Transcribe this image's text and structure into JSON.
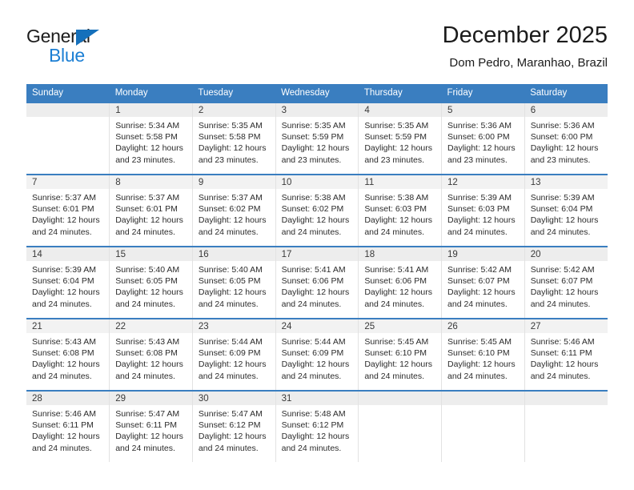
{
  "brand": {
    "name_part1": "General",
    "name_part2": "Blue",
    "color_dark": "#1b1b1b",
    "color_blue": "#1c7fd4",
    "triangle_color": "#1570bb"
  },
  "header": {
    "title": "December 2025",
    "subtitle": "Dom Pedro, Maranhao, Brazil"
  },
  "theme": {
    "header_bg": "#3a7ec0",
    "header_text": "#ffffff",
    "row_divider": "#3a7ec0",
    "daynum_bg": "#f2f2f2",
    "daynum_bg_alt": "#ededed",
    "cell_divider": "#e2e2e2"
  },
  "weekday_headers": [
    "Sunday",
    "Monday",
    "Tuesday",
    "Wednesday",
    "Thursday",
    "Friday",
    "Saturday"
  ],
  "weeks": [
    {
      "shaded": true,
      "days": [
        {
          "date": "",
          "sunrise": "",
          "sunset": "",
          "daylight_line1": "",
          "daylight_line2": ""
        },
        {
          "date": "1",
          "sunrise": "Sunrise: 5:34 AM",
          "sunset": "Sunset: 5:58 PM",
          "daylight_line1": "Daylight: 12 hours",
          "daylight_line2": "and 23 minutes."
        },
        {
          "date": "2",
          "sunrise": "Sunrise: 5:35 AM",
          "sunset": "Sunset: 5:58 PM",
          "daylight_line1": "Daylight: 12 hours",
          "daylight_line2": "and 23 minutes."
        },
        {
          "date": "3",
          "sunrise": "Sunrise: 5:35 AM",
          "sunset": "Sunset: 5:59 PM",
          "daylight_line1": "Daylight: 12 hours",
          "daylight_line2": "and 23 minutes."
        },
        {
          "date": "4",
          "sunrise": "Sunrise: 5:35 AM",
          "sunset": "Sunset: 5:59 PM",
          "daylight_line1": "Daylight: 12 hours",
          "daylight_line2": "and 23 minutes."
        },
        {
          "date": "5",
          "sunrise": "Sunrise: 5:36 AM",
          "sunset": "Sunset: 6:00 PM",
          "daylight_line1": "Daylight: 12 hours",
          "daylight_line2": "and 23 minutes."
        },
        {
          "date": "6",
          "sunrise": "Sunrise: 5:36 AM",
          "sunset": "Sunset: 6:00 PM",
          "daylight_line1": "Daylight: 12 hours",
          "daylight_line2": "and 23 minutes."
        }
      ]
    },
    {
      "shaded": false,
      "days": [
        {
          "date": "7",
          "sunrise": "Sunrise: 5:37 AM",
          "sunset": "Sunset: 6:01 PM",
          "daylight_line1": "Daylight: 12 hours",
          "daylight_line2": "and 24 minutes."
        },
        {
          "date": "8",
          "sunrise": "Sunrise: 5:37 AM",
          "sunset": "Sunset: 6:01 PM",
          "daylight_line1": "Daylight: 12 hours",
          "daylight_line2": "and 24 minutes."
        },
        {
          "date": "9",
          "sunrise": "Sunrise: 5:37 AM",
          "sunset": "Sunset: 6:02 PM",
          "daylight_line1": "Daylight: 12 hours",
          "daylight_line2": "and 24 minutes."
        },
        {
          "date": "10",
          "sunrise": "Sunrise: 5:38 AM",
          "sunset": "Sunset: 6:02 PM",
          "daylight_line1": "Daylight: 12 hours",
          "daylight_line2": "and 24 minutes."
        },
        {
          "date": "11",
          "sunrise": "Sunrise: 5:38 AM",
          "sunset": "Sunset: 6:03 PM",
          "daylight_line1": "Daylight: 12 hours",
          "daylight_line2": "and 24 minutes."
        },
        {
          "date": "12",
          "sunrise": "Sunrise: 5:39 AM",
          "sunset": "Sunset: 6:03 PM",
          "daylight_line1": "Daylight: 12 hours",
          "daylight_line2": "and 24 minutes."
        },
        {
          "date": "13",
          "sunrise": "Sunrise: 5:39 AM",
          "sunset": "Sunset: 6:04 PM",
          "daylight_line1": "Daylight: 12 hours",
          "daylight_line2": "and 24 minutes."
        }
      ]
    },
    {
      "shaded": true,
      "days": [
        {
          "date": "14",
          "sunrise": "Sunrise: 5:39 AM",
          "sunset": "Sunset: 6:04 PM",
          "daylight_line1": "Daylight: 12 hours",
          "daylight_line2": "and 24 minutes."
        },
        {
          "date": "15",
          "sunrise": "Sunrise: 5:40 AM",
          "sunset": "Sunset: 6:05 PM",
          "daylight_line1": "Daylight: 12 hours",
          "daylight_line2": "and 24 minutes."
        },
        {
          "date": "16",
          "sunrise": "Sunrise: 5:40 AM",
          "sunset": "Sunset: 6:05 PM",
          "daylight_line1": "Daylight: 12 hours",
          "daylight_line2": "and 24 minutes."
        },
        {
          "date": "17",
          "sunrise": "Sunrise: 5:41 AM",
          "sunset": "Sunset: 6:06 PM",
          "daylight_line1": "Daylight: 12 hours",
          "daylight_line2": "and 24 minutes."
        },
        {
          "date": "18",
          "sunrise": "Sunrise: 5:41 AM",
          "sunset": "Sunset: 6:06 PM",
          "daylight_line1": "Daylight: 12 hours",
          "daylight_line2": "and 24 minutes."
        },
        {
          "date": "19",
          "sunrise": "Sunrise: 5:42 AM",
          "sunset": "Sunset: 6:07 PM",
          "daylight_line1": "Daylight: 12 hours",
          "daylight_line2": "and 24 minutes."
        },
        {
          "date": "20",
          "sunrise": "Sunrise: 5:42 AM",
          "sunset": "Sunset: 6:07 PM",
          "daylight_line1": "Daylight: 12 hours",
          "daylight_line2": "and 24 minutes."
        }
      ]
    },
    {
      "shaded": false,
      "days": [
        {
          "date": "21",
          "sunrise": "Sunrise: 5:43 AM",
          "sunset": "Sunset: 6:08 PM",
          "daylight_line1": "Daylight: 12 hours",
          "daylight_line2": "and 24 minutes."
        },
        {
          "date": "22",
          "sunrise": "Sunrise: 5:43 AM",
          "sunset": "Sunset: 6:08 PM",
          "daylight_line1": "Daylight: 12 hours",
          "daylight_line2": "and 24 minutes."
        },
        {
          "date": "23",
          "sunrise": "Sunrise: 5:44 AM",
          "sunset": "Sunset: 6:09 PM",
          "daylight_line1": "Daylight: 12 hours",
          "daylight_line2": "and 24 minutes."
        },
        {
          "date": "24",
          "sunrise": "Sunrise: 5:44 AM",
          "sunset": "Sunset: 6:09 PM",
          "daylight_line1": "Daylight: 12 hours",
          "daylight_line2": "and 24 minutes."
        },
        {
          "date": "25",
          "sunrise": "Sunrise: 5:45 AM",
          "sunset": "Sunset: 6:10 PM",
          "daylight_line1": "Daylight: 12 hours",
          "daylight_line2": "and 24 minutes."
        },
        {
          "date": "26",
          "sunrise": "Sunrise: 5:45 AM",
          "sunset": "Sunset: 6:10 PM",
          "daylight_line1": "Daylight: 12 hours",
          "daylight_line2": "and 24 minutes."
        },
        {
          "date": "27",
          "sunrise": "Sunrise: 5:46 AM",
          "sunset": "Sunset: 6:11 PM",
          "daylight_line1": "Daylight: 12 hours",
          "daylight_line2": "and 24 minutes."
        }
      ]
    },
    {
      "shaded": true,
      "days": [
        {
          "date": "28",
          "sunrise": "Sunrise: 5:46 AM",
          "sunset": "Sunset: 6:11 PM",
          "daylight_line1": "Daylight: 12 hours",
          "daylight_line2": "and 24 minutes."
        },
        {
          "date": "29",
          "sunrise": "Sunrise: 5:47 AM",
          "sunset": "Sunset: 6:11 PM",
          "daylight_line1": "Daylight: 12 hours",
          "daylight_line2": "and 24 minutes."
        },
        {
          "date": "30",
          "sunrise": "Sunrise: 5:47 AM",
          "sunset": "Sunset: 6:12 PM",
          "daylight_line1": "Daylight: 12 hours",
          "daylight_line2": "and 24 minutes."
        },
        {
          "date": "31",
          "sunrise": "Sunrise: 5:48 AM",
          "sunset": "Sunset: 6:12 PM",
          "daylight_line1": "Daylight: 12 hours",
          "daylight_line2": "and 24 minutes."
        },
        {
          "date": "",
          "sunrise": "",
          "sunset": "",
          "daylight_line1": "",
          "daylight_line2": ""
        },
        {
          "date": "",
          "sunrise": "",
          "sunset": "",
          "daylight_line1": "",
          "daylight_line2": ""
        },
        {
          "date": "",
          "sunrise": "",
          "sunset": "",
          "daylight_line1": "",
          "daylight_line2": ""
        }
      ]
    }
  ]
}
